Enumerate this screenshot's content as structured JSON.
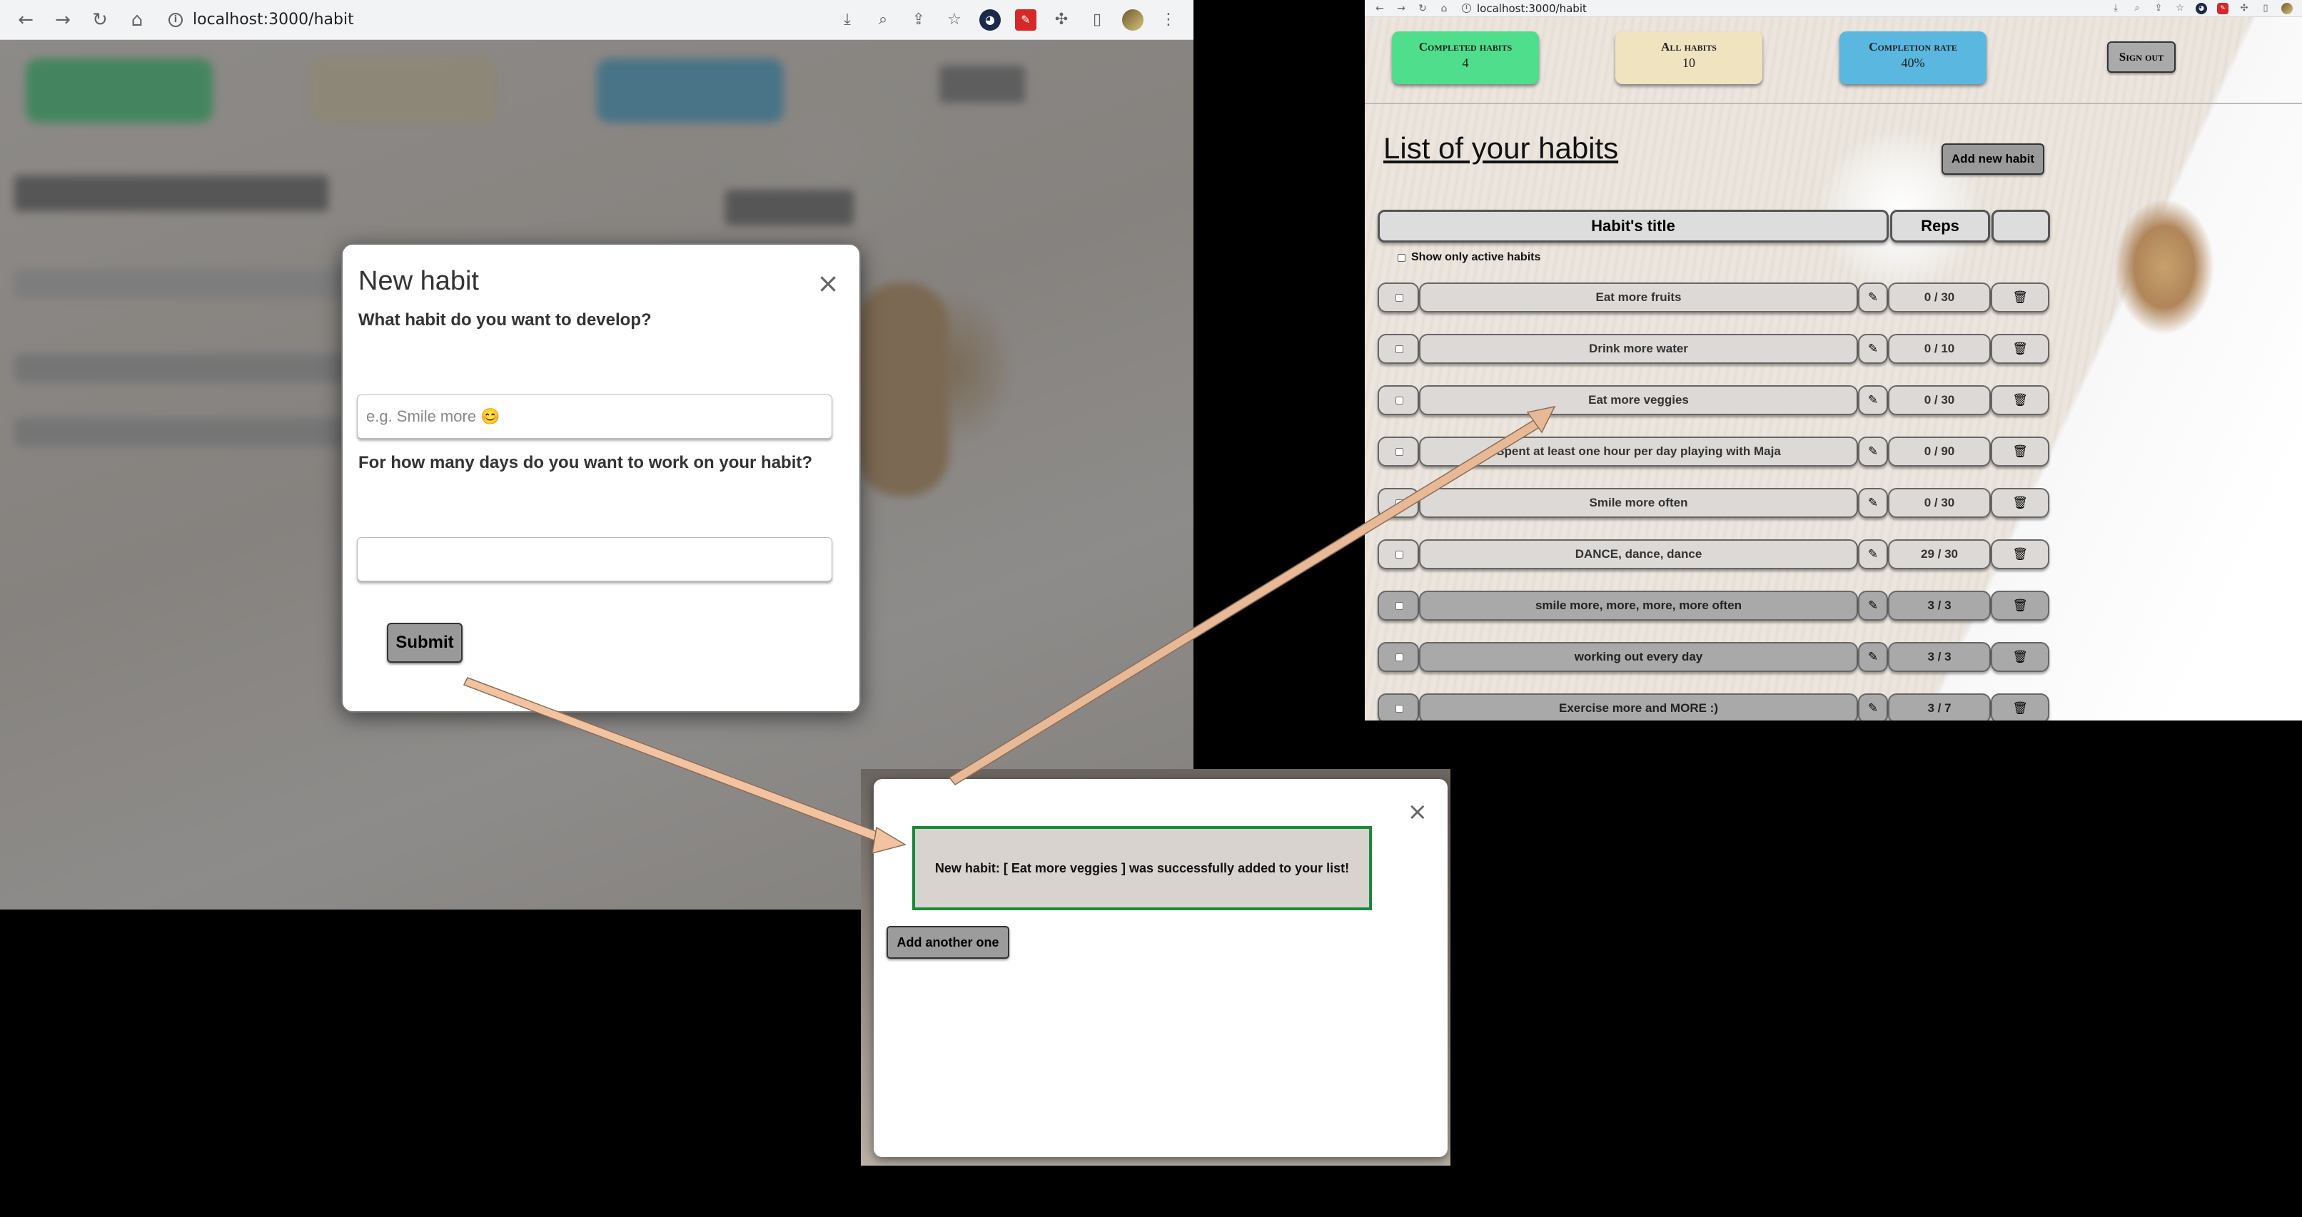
{
  "left": {
    "url": "localhost:3000/habit",
    "modal": {
      "title": "New habit",
      "close": "×",
      "question1": "What habit do you want to develop?",
      "habit_placeholder": "e.g. Smile more 😊",
      "question2": "For how many days do you want to work on your habit?",
      "days_value": "",
      "submit": "Submit"
    }
  },
  "right": {
    "url": "localhost:3000/habit",
    "stats": [
      {
        "label": "Completed habits",
        "value": "4",
        "color": "#4fde8b"
      },
      {
        "label": "All habits",
        "value": "10",
        "color": "#f0e3c0"
      },
      {
        "label": "Completion rate",
        "value": "40%",
        "color": "#5ab7e0"
      }
    ],
    "signout": "Sign out",
    "list_title": "List of your habits",
    "add_new": "Add new habit",
    "columns": {
      "title": "Habit's title",
      "reps": "Reps",
      "actions": ""
    },
    "filter_label": "Show only active habits",
    "habits": [
      {
        "title": "Eat more fruits",
        "reps": "0 / 30",
        "done": false
      },
      {
        "title": "Drink more water",
        "reps": "0 / 10",
        "done": false
      },
      {
        "title": "Eat more veggies",
        "reps": "0 / 30",
        "done": false
      },
      {
        "title": "Spent at least one hour per day playing with Maja",
        "reps": "0 / 90",
        "done": false
      },
      {
        "title": "Smile more often",
        "reps": "0 / 30",
        "done": false
      },
      {
        "title": "DANCE, dance, dance",
        "reps": "29 / 30",
        "done": false
      },
      {
        "title": "smile more, more, more, more often",
        "reps": "3 / 3",
        "done": true
      },
      {
        "title": "working out every day",
        "reps": "3 / 3",
        "done": true
      },
      {
        "title": "Exercise more and MORE :)",
        "reps": "3 / 7",
        "done": true
      }
    ]
  },
  "success": {
    "close": "×",
    "message": "New habit: [ Eat more veggies ] was successfully added to your list!",
    "add_another": "Add another one"
  },
  "icons": {
    "edit": "pencil-icon",
    "delete": "trash-icon"
  }
}
